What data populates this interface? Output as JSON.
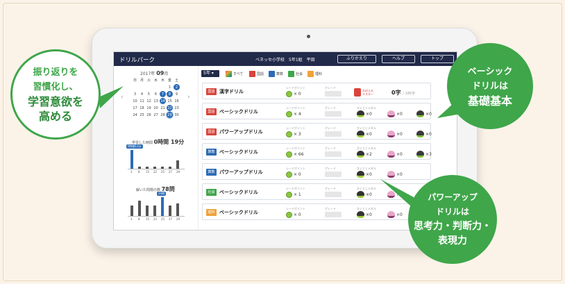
{
  "app": {
    "title": "ドリルパーク",
    "school": "ベネッセ小学校　5年1組　平田",
    "buttons": [
      "ふりかえり",
      "ヘルプ",
      "トップ"
    ]
  },
  "calendar": {
    "year_label": "2017年",
    "month": "09",
    "month_suffix": "月",
    "weekdays": [
      "日",
      "月",
      "火",
      "水",
      "木",
      "金",
      "土"
    ],
    "days": [
      "",
      "",
      "",
      "",
      "",
      "1",
      "2",
      "3",
      "4",
      "5",
      "6",
      "7",
      "8",
      "9",
      "10",
      "11",
      "12",
      "13",
      "14",
      "15",
      "16",
      "17",
      "18",
      "19",
      "20",
      "21",
      "22",
      "23",
      "24",
      "25",
      "26",
      "27",
      "28",
      "29",
      "30"
    ],
    "highlighted": [
      "2",
      "7",
      "8",
      "14",
      "22",
      "29"
    ],
    "today": "29",
    "prev": "‹",
    "next": "›"
  },
  "stats": {
    "study_time_label": "学習した時間",
    "study_time_value": "0時間 19分",
    "study_bars_tag": "0時間12分",
    "study_bars_x": [
      "3",
      "8",
      "15",
      "22",
      "25",
      "27",
      "29"
    ],
    "study_bars_values": [
      0.9,
      0.1,
      0.1,
      0.1,
      0.1,
      0.1,
      0.4
    ],
    "solved_label": "解いた問題の数",
    "solved_value": "78問",
    "solved_bars_tag": "24問",
    "solved_bars_values": [
      0.5,
      0.75,
      0.5,
      0.5,
      0.9,
      0.5,
      0.6
    ]
  },
  "filters": {
    "grade": "5年 ▾",
    "items": [
      {
        "label": "すべて",
        "color": "#e04a4a"
      },
      {
        "label": "国語",
        "color": "#d8443b"
      },
      {
        "label": "算数",
        "color": "#2d6bb5"
      },
      {
        "label": "社会",
        "color": "#3fa64a"
      },
      {
        "label": "理科",
        "color": "#f0a13a"
      }
    ]
  },
  "drills": [
    {
      "subject": "国語",
      "subject_color": "#d8443b",
      "name": "漢字ドリル",
      "seed_label": "シードポイント",
      "seed": "× 0",
      "grade_label": "グレード",
      "type": "kanji",
      "master": "おぼえる\nマスター",
      "count": "0字",
      "count_total": "/ 185字"
    },
    {
      "subject": "国語",
      "subject_color": "#d8443b",
      "name": "ベーシックドリル",
      "seed_label": "シードポイント",
      "seed": "× 4",
      "grade_label": "グレード",
      "medal_label": "かくとくメダル",
      "medals": [
        "0",
        "0",
        "0"
      ]
    },
    {
      "subject": "国語",
      "subject_color": "#d8443b",
      "name": "パワーアップドリル",
      "seed_label": "シードポイント",
      "seed": "× 3",
      "grade_label": "グレード",
      "medal_label": "かくとくメダル",
      "medals": [
        "0",
        "0",
        "0"
      ]
    },
    {
      "subject": "算数",
      "subject_color": "#2d6bb5",
      "name": "ベーシックドリル",
      "seed_label": "シードポイント",
      "seed": "× 66",
      "grade_label": "グレード",
      "medal_label": "かくとくメダル",
      "medals": [
        "2",
        "0",
        "3"
      ]
    },
    {
      "subject": "算数",
      "subject_color": "#2d6bb5",
      "name": "パワーアップドリル",
      "seed_label": "シードポイント",
      "seed": "× 0",
      "grade_label": "グレード",
      "medal_label": "かくとくメダル",
      "medals": [
        "0",
        "0",
        ""
      ]
    },
    {
      "subject": "社会",
      "subject_color": "#3fa64a",
      "name": "ベーシックドリル",
      "seed_label": "シードポイント",
      "seed": "× 1",
      "grade_label": "グレード",
      "medal_label": "かくとくメダル",
      "medals": [
        "0",
        "0",
        ""
      ]
    },
    {
      "subject": "理科",
      "subject_color": "#f0a13a",
      "name": "ベーシックドリル",
      "seed_label": "シードポイント",
      "seed": "× 0",
      "grade_label": "グレード",
      "medal_label": "かくとくメダル",
      "medals": [
        "0",
        "0",
        ""
      ]
    }
  ],
  "callouts": {
    "left": [
      "振り返りを",
      "習慣化し、",
      "学習意欲を",
      "高める"
    ],
    "right_top": [
      "ベーシック",
      "ドリルは",
      "基礎基本"
    ],
    "right_bottom": [
      "パワーアップ",
      "ドリルは",
      "思考力・判断力・",
      "表現力"
    ]
  },
  "colors": {
    "topbar": "#222a4a",
    "accent_green": "#3fa64a",
    "calendar_blue": "#2d6bb5"
  }
}
